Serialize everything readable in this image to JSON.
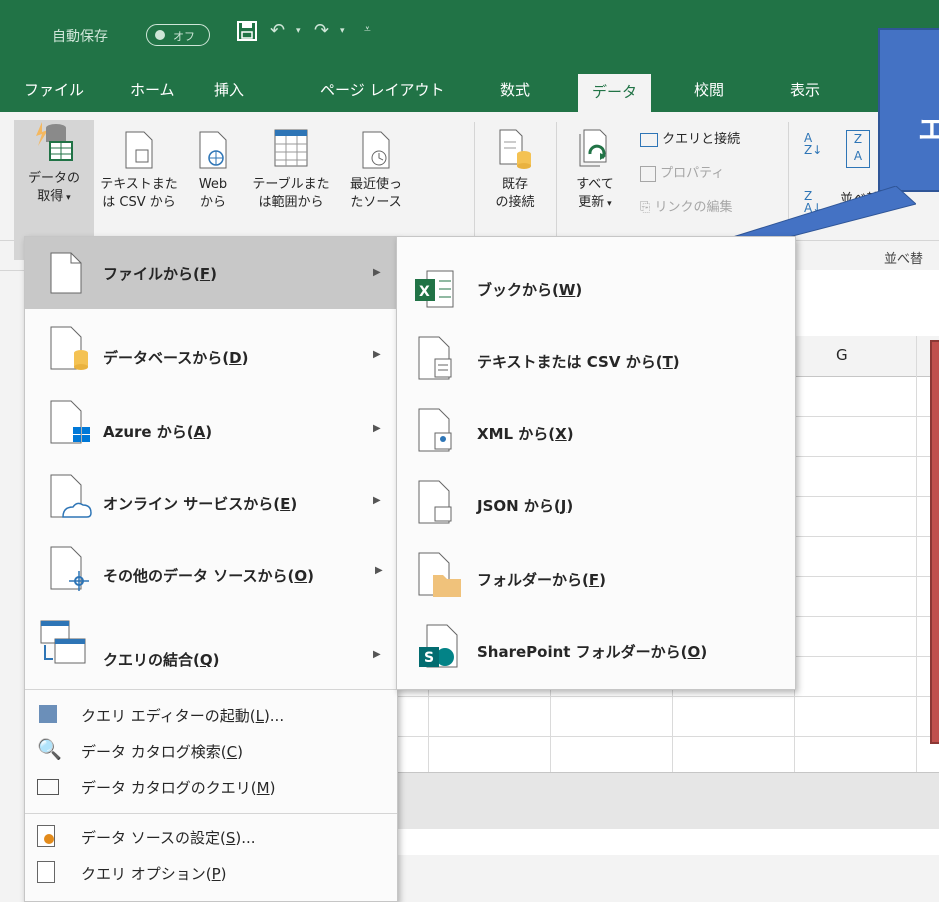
{
  "qat": {
    "autosave_label": "自動保存",
    "autosave_state": "オフ"
  },
  "tabs": [
    "ファイル",
    "ホーム",
    "挿入",
    "ページ レイアウト",
    "数式",
    "データ",
    "校閲",
    "表示"
  ],
  "active_tab": "データ",
  "ribbon": {
    "get_data": [
      "データの",
      "取得"
    ],
    "text_csv": [
      "テキストまた",
      "は CSV から"
    ],
    "web": [
      "Web",
      "から"
    ],
    "table_range": [
      "テーブルまた",
      "は範囲から"
    ],
    "recent_sources": [
      "最近使っ",
      "たソース"
    ],
    "existing_conn": [
      "既存",
      "の接続"
    ],
    "refresh_all": [
      "すべて",
      "更新"
    ],
    "queries_conn": "クエリと接続",
    "properties": "プロパティ",
    "edit_links": "リンクの編集",
    "sort": "並べ替え",
    "sort_group": "並べ替"
  },
  "sheet": {
    "column_g": "G"
  },
  "callout_text": "エ",
  "main_menu": {
    "items": [
      {
        "label": "ファイルから(",
        "key": "F",
        "tail": ")",
        "icon": "file-icon"
      },
      {
        "label": "データベースから(",
        "key": "D",
        "tail": ")",
        "icon": "database-icon"
      },
      {
        "label": "Azure から(",
        "key": "A",
        "tail": ")",
        "icon": "azure-icon"
      },
      {
        "label": "オンライン サービスから(",
        "key": "E",
        "tail": ")",
        "icon": "cloud-icon"
      },
      {
        "label": "その他のデータ ソースから(",
        "key": "O",
        "tail": ")",
        "icon": "other-source-icon"
      },
      {
        "label": "クエリの結合(",
        "key": "Q",
        "tail": ")",
        "icon": "combine-query-icon"
      }
    ],
    "commands": [
      {
        "label": "クエリ エディターの起動(",
        "key": "L",
        "tail": ")..."
      },
      {
        "label": "データ カタログ検索(",
        "key": "C",
        "tail": ")"
      },
      {
        "label": "データ カタログのクエリ(",
        "key": "M",
        "tail": ")"
      },
      {
        "label": "データ ソースの設定(",
        "key": "S",
        "tail": ")..."
      },
      {
        "label": "クエリ オプション(",
        "key": "P",
        "tail": ")"
      }
    ]
  },
  "sub_menu": {
    "items": [
      {
        "label": "ブックから(",
        "key": "W",
        "tail": ")"
      },
      {
        "label": "テキストまたは CSV から(",
        "key": "T",
        "tail": ")"
      },
      {
        "label": "XML から(",
        "key": "X",
        "tail": ")"
      },
      {
        "label": "JSON から(",
        "key": "J",
        "tail": ")"
      },
      {
        "label": "フォルダーから(",
        "key": "F",
        "tail": ")"
      },
      {
        "label": "SharePoint フォルダーから(",
        "key": "O",
        "tail": ")"
      }
    ]
  },
  "colors": {
    "excel_green": "#217346",
    "callout_blue": "#4472c4",
    "callout_red": "#c0504d"
  }
}
